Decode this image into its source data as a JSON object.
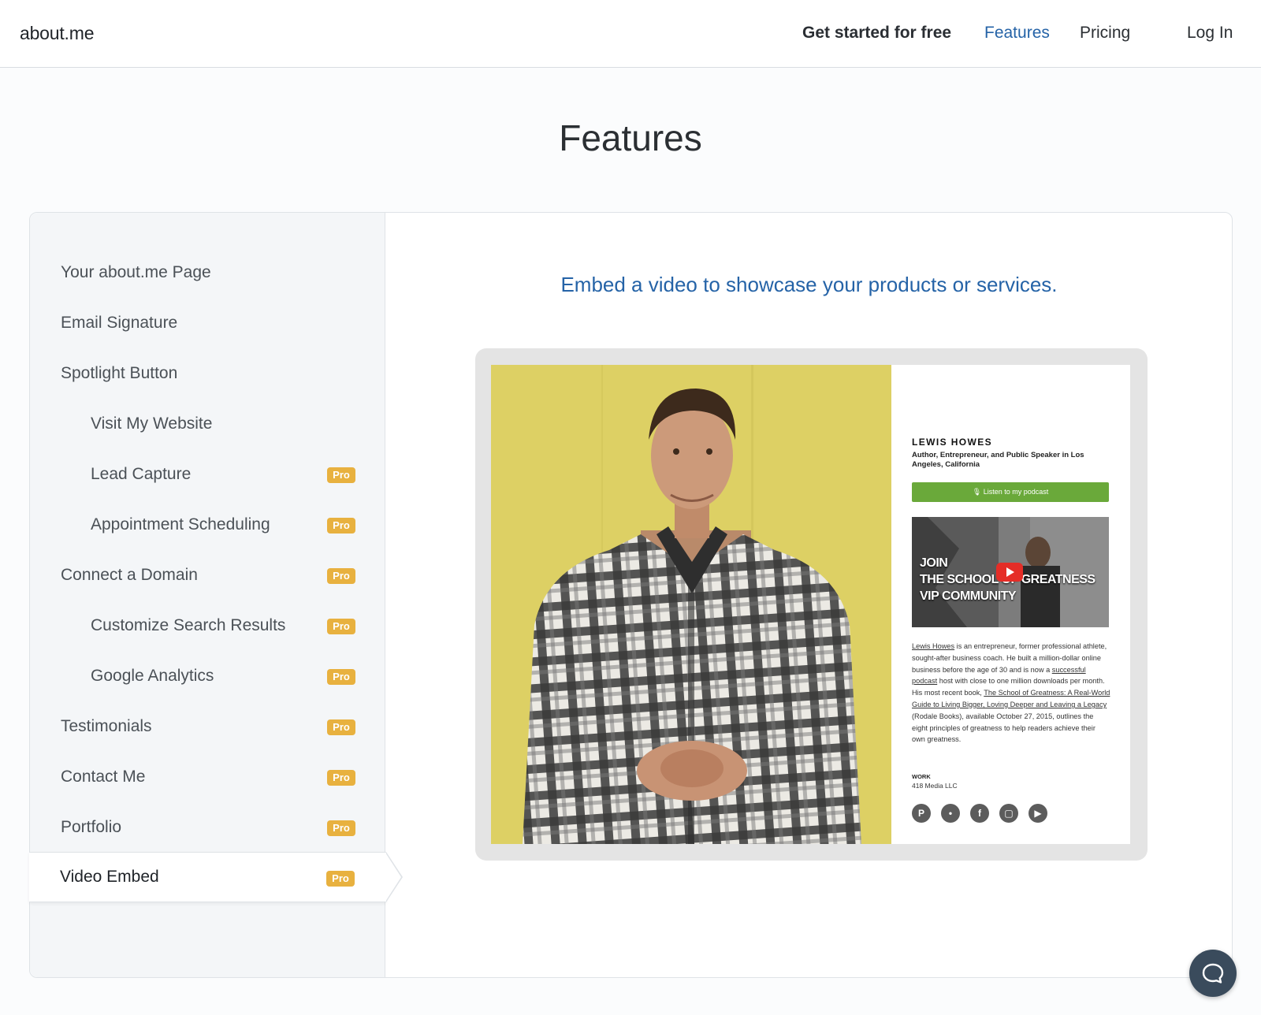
{
  "header": {
    "logo": "about.me",
    "nav": {
      "get_started": "Get started for free",
      "features": "Features",
      "pricing": "Pricing",
      "login": "Log In"
    }
  },
  "page": {
    "title": "Features"
  },
  "sidebar": {
    "pro_badge": "Pro",
    "items": [
      {
        "label": "Your about.me Page",
        "level": 1,
        "pro": false
      },
      {
        "label": "Email Signature",
        "level": 1,
        "pro": false
      },
      {
        "label": "Spotlight Button",
        "level": 1,
        "pro": false
      },
      {
        "label": "Visit My Website",
        "level": 2,
        "pro": false
      },
      {
        "label": "Lead Capture",
        "level": 2,
        "pro": true
      },
      {
        "label": "Appointment Scheduling",
        "level": 2,
        "pro": true
      },
      {
        "label": "Connect a Domain",
        "level": 1,
        "pro": true
      },
      {
        "label": "Customize Search Results",
        "level": 2,
        "pro": true
      },
      {
        "label": "Google Analytics",
        "level": 2,
        "pro": true
      },
      {
        "label": "Testimonials",
        "level": 1,
        "pro": true
      },
      {
        "label": "Contact Me",
        "level": 1,
        "pro": true
      },
      {
        "label": "Portfolio",
        "level": 1,
        "pro": true
      },
      {
        "label": "Video Embed",
        "level": 1,
        "pro": true,
        "active": true
      }
    ]
  },
  "feature": {
    "heading": "Embed a video to showcase your products or services.",
    "preview": {
      "name": "LEWIS HOWES",
      "tagline": "Author, Entrepreneur, and Public Speaker in Los Angeles, California",
      "button": "Listen to my podcast",
      "video_text": [
        "JOIN",
        "THE SCHOOL OF GREATNESS",
        "VIP COMMUNITY"
      ],
      "bio": {
        "link1": "Lewis Howes",
        "t1": " is an entrepreneur, former professional athlete, sought-after business coach. He built a million-dollar online business before the age of 30 and is now a ",
        "link2": "successful podcast",
        "t2": " host with close to one million downloads per month. His most recent book, ",
        "link3": "The School of Greatness: A Real-World Guide to Living Bigger, Loving Deeper and Leaving a Legacy",
        "t3": " (Rodale Books), available October 27, 2015, outlines the eight principles of greatness to help readers achieve their own greatness."
      },
      "work_heading": "WORK",
      "work": "418 Media LLC",
      "social": [
        "pinterest-icon",
        "twitter-icon",
        "facebook-icon",
        "instagram-icon",
        "youtube-icon"
      ]
    }
  },
  "colors": {
    "accent": "#2563a7",
    "pro_badge": "#e8b13f",
    "podcast_button": "#6aa93a",
    "chat_button": "#3a4b5c"
  }
}
